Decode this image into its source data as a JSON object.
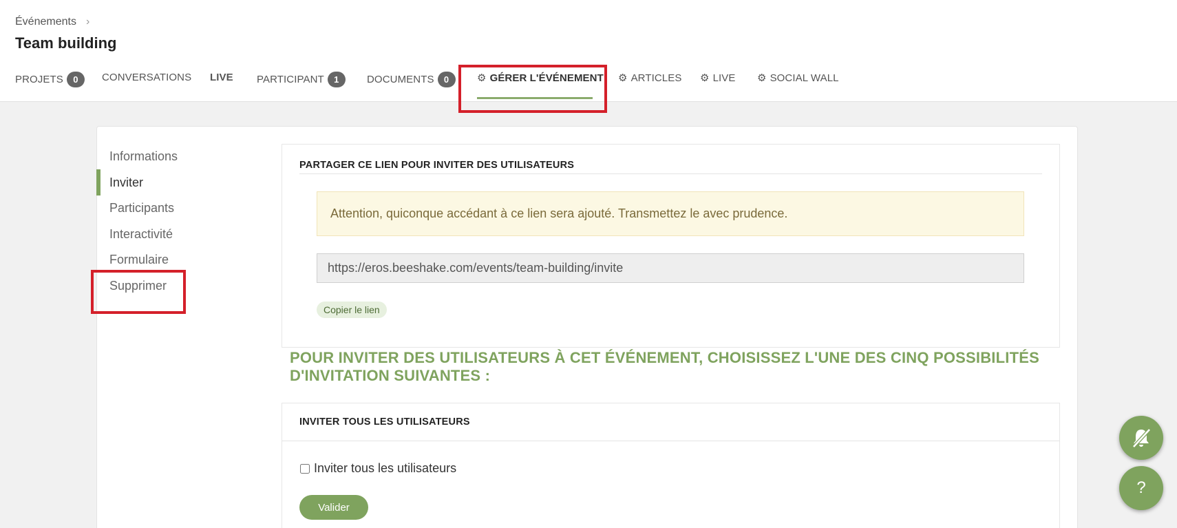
{
  "breadcrumb": {
    "parent": "Événements"
  },
  "page": {
    "title": "Team building"
  },
  "tabs": [
    {
      "label": "PROJETS",
      "badge": "0"
    },
    {
      "label": "CONVERSATIONS"
    },
    {
      "label": "LIVE"
    },
    {
      "label": "PARTICIPANT",
      "badge": "1"
    },
    {
      "label": "DOCUMENTS",
      "badge": "0"
    },
    {
      "label": "GÉRER L'ÉVÉNEMENT",
      "active": true
    },
    {
      "label": "ARTICLES"
    },
    {
      "label": "LIVE"
    },
    {
      "label": "SOCIAL WALL"
    }
  ],
  "sidenav": {
    "items": [
      "Informations",
      "Inviter",
      "Participants",
      "Interactivité",
      "Formulaire",
      "Supprimer"
    ],
    "active": "Inviter"
  },
  "share_panel": {
    "title": "PARTAGER CE LIEN POUR INVITER DES UTILISATEURS",
    "warning": "Attention, quiconque accédant à ce lien sera ajouté. Transmettez le avec prudence.",
    "link": "https://eros.beeshake.com/events/team-building/invite",
    "copy_label": "Copier le lien"
  },
  "invite_heading": "POUR INVITER DES UTILISATEURS À CET ÉVÉNEMENT, CHOISISSEZ L'UNE DES CINQ POSSIBILITÉS D'INVITATION SUIVANTES :",
  "invite_all_panel": {
    "title": "INVITER TOUS LES UTILISATEURS",
    "checkbox_label": "Inviter tous les utilisateurs",
    "submit_label": "Valider"
  },
  "fabs": {
    "help_label": "?"
  },
  "colors": {
    "accent": "#7fa35e",
    "highlight": "#d4202a",
    "warning_bg": "#fcf8e3"
  },
  "icons": [
    "chevron-right-icon",
    "gear-icon",
    "bell-slash-icon"
  ]
}
